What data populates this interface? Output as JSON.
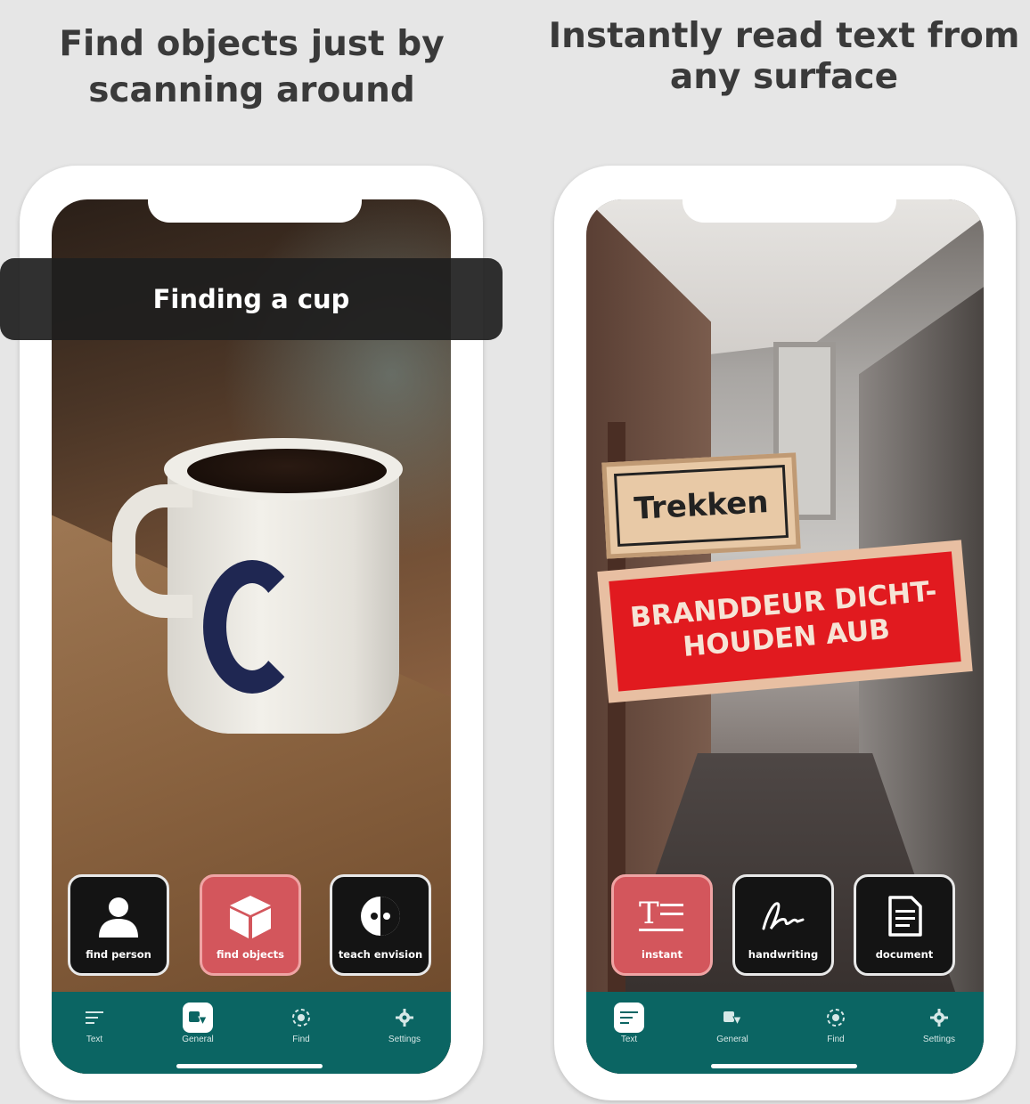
{
  "panels": [
    {
      "headline": [
        "Find objects just by",
        "scanning around"
      ],
      "banner": "Finding a cup",
      "tiles": [
        {
          "label": "find person",
          "icon": "person-icon",
          "active": false
        },
        {
          "label": "find objects",
          "icon": "cube-icon",
          "active": true
        },
        {
          "label": "teach envision",
          "icon": "half-circle-icon",
          "active": false
        }
      ]
    },
    {
      "headline": [
        "Instantly read text from",
        "any surface"
      ],
      "signs": {
        "trekken": "Trekken",
        "brand_line1": "BRANDDEUR DICHT-",
        "brand_line2": "HOUDEN AUB"
      },
      "tiles": [
        {
          "label": "instant",
          "icon": "text-instant-icon",
          "active": true
        },
        {
          "label": "handwriting",
          "icon": "signature-icon",
          "active": false
        },
        {
          "label": "document",
          "icon": "document-icon",
          "active": false
        }
      ]
    }
  ],
  "nav": {
    "items": [
      "Text",
      "General",
      "Find",
      "Settings"
    ]
  },
  "colors": {
    "navbar": "#0b6563",
    "active_tile": "#d3565c",
    "banner": "#1e1e1e"
  }
}
